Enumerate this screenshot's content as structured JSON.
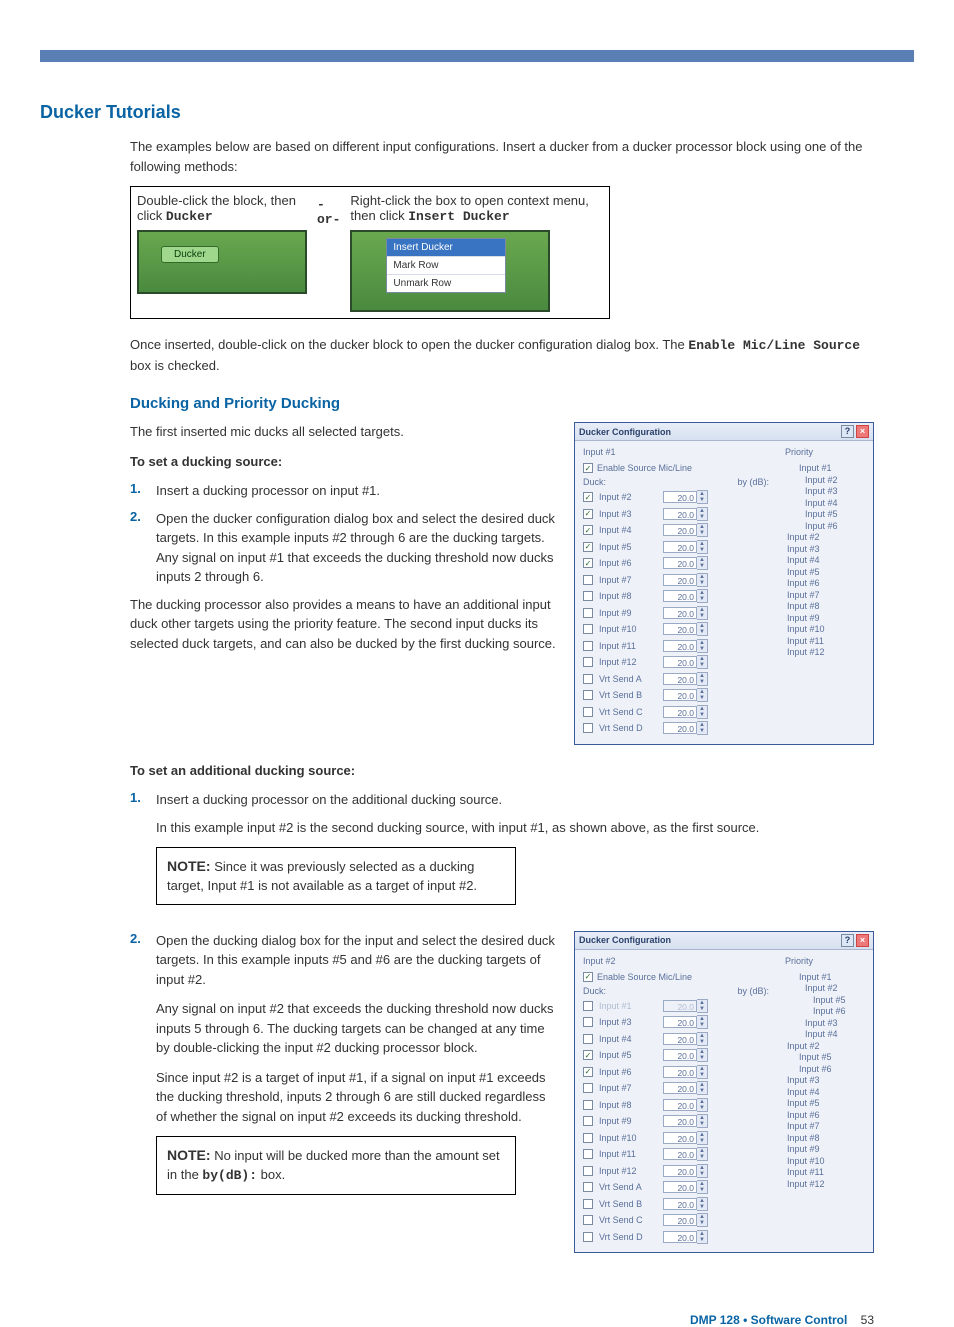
{
  "headings": {
    "h1": "Ducker Tutorials",
    "h2": "Ducking and Priority Ducking"
  },
  "intro": {
    "p1": "The examples below are based on different input configurations. Insert a ducker from a ducker processor block using one of the following methods:",
    "p2_a": "Once inserted, double-click on the ducker block to open the ducker configuration dialog box. The ",
    "p2_code": "Enable Mic/Line Source",
    "p2_b": " box is checked."
  },
  "insert_fig": {
    "left_a": "Double-click the block, then click ",
    "left_code": "Ducker",
    "or": "-or-",
    "right_a": "Right-click the box to open context menu, then click ",
    "right_code": "Insert Ducker",
    "pill": "Ducker",
    "ctx": [
      "Insert Ducker",
      "Mark Row",
      "Unmark Row"
    ]
  },
  "section1": {
    "p1": "The first inserted mic ducks all selected targets.",
    "h_src": "To set a ducking source:",
    "step1": "Insert a ducking processor on input #1.",
    "step2a": "Open the ducker configuration dialog box and select the desired duck targets. In this example inputs #2 through 6 are the ducking targets.",
    "step2b": "Any signal on input #1 that exceeds the ducking threshold now ducks inputs 2 through 6.",
    "p_after": "The ducking processor also provides a means to have an additional input duck other targets using the priority feature. The second input ducks its selected duck targets, and can also be ducked by the first ducking source."
  },
  "section2": {
    "h_add": "To set an additional ducking source:",
    "s1": "Insert a ducking processor on the additional ducking source.",
    "s1b": "In this example input #2 is the second ducking source, with input #1, as shown above, as the first source.",
    "note1_label": "NOTE:",
    "note1_body": "Since it was previously selected as a ducking target, Input #1 is not available as a target of input #2.",
    "s2a": "Open the ducking dialog box for the input and select the desired duck targets. In this example inputs #5 and #6 are the ducking targets of input #2.",
    "s2b": "Any signal on input #2 that exceeds the ducking threshold now ducks inputs 5 through 6. The ducking targets can be changed at any time by double-clicking the input #2 ducking processor block.",
    "s2c": "Since input #2 is a target of input #1, if a signal on input #1 exceeds the ducking threshold, inputs 2 through 6 are still ducked regardless of whether the signal on input #2 exceeds its ducking threshold.",
    "note2_label": "NOTE:",
    "note2_body_a": "No input will be ducked more than the amount set in the ",
    "note2_code": "by(dB):",
    "note2_body_b": " box."
  },
  "dlg1": {
    "title": "Ducker Configuration",
    "input_label": "Input #1",
    "enable": "Enable Source Mic/Line",
    "duck": "Duck:",
    "bydb": "by (dB):",
    "rows": [
      {
        "label": "Input #2",
        "checked": true,
        "val": "20.0"
      },
      {
        "label": "Input #3",
        "checked": true,
        "val": "20.0"
      },
      {
        "label": "Input #4",
        "checked": true,
        "val": "20.0"
      },
      {
        "label": "Input #5",
        "checked": true,
        "val": "20.0"
      },
      {
        "label": "Input #6",
        "checked": true,
        "val": "20.0"
      },
      {
        "label": "Input #7",
        "checked": false,
        "val": "20.0"
      },
      {
        "label": "Input #8",
        "checked": false,
        "val": "20.0"
      },
      {
        "label": "Input #9",
        "checked": false,
        "val": "20.0"
      },
      {
        "label": "Input #10",
        "checked": false,
        "val": "20.0"
      },
      {
        "label": "Input #11",
        "checked": false,
        "val": "20.0"
      },
      {
        "label": "Input #12",
        "checked": false,
        "val": "20.0"
      },
      {
        "label": "Vrt Send A",
        "checked": false,
        "val": "20.0"
      },
      {
        "label": "Vrt Send B",
        "checked": false,
        "val": "20.0"
      },
      {
        "label": "Vrt Send C",
        "checked": false,
        "val": "20.0"
      },
      {
        "label": "Vrt Send D",
        "checked": false,
        "val": "20.0"
      }
    ],
    "priority_label": "Priority",
    "tree": [
      {
        "t": "Input #1",
        "cls": "ind1"
      },
      {
        "t": "Input #2",
        "cls": "ind2"
      },
      {
        "t": "Input #3",
        "cls": "ind2"
      },
      {
        "t": "Input #4",
        "cls": "ind2"
      },
      {
        "t": "Input #5",
        "cls": "ind2"
      },
      {
        "t": "Input #6",
        "cls": "ind2"
      },
      {
        "t": "Input #2",
        "cls": "root"
      },
      {
        "t": "Input #3",
        "cls": "root"
      },
      {
        "t": "Input #4",
        "cls": "root"
      },
      {
        "t": "Input #5",
        "cls": "root"
      },
      {
        "t": "Input #6",
        "cls": "root"
      },
      {
        "t": "Input #7",
        "cls": "root"
      },
      {
        "t": "Input #8",
        "cls": "root"
      },
      {
        "t": "Input #9",
        "cls": "root"
      },
      {
        "t": "Input #10",
        "cls": "root"
      },
      {
        "t": "Input #11",
        "cls": "root"
      },
      {
        "t": "Input #12",
        "cls": "root"
      }
    ]
  },
  "dlg2": {
    "title": "Ducker Configuration",
    "input_label": "Input #2",
    "enable": "Enable Source Mic/Line",
    "duck": "Duck:",
    "bydb": "by (dB):",
    "rows": [
      {
        "label": "Input #1",
        "checked": false,
        "val": "20.0",
        "disabled": true
      },
      {
        "label": "Input #3",
        "checked": false,
        "val": "20.0"
      },
      {
        "label": "Input #4",
        "checked": false,
        "val": "20.0"
      },
      {
        "label": "Input #5",
        "checked": true,
        "val": "20.0"
      },
      {
        "label": "Input #6",
        "checked": true,
        "val": "20.0"
      },
      {
        "label": "Input #7",
        "checked": false,
        "val": "20.0"
      },
      {
        "label": "Input #8",
        "checked": false,
        "val": "20.0"
      },
      {
        "label": "Input #9",
        "checked": false,
        "val": "20.0"
      },
      {
        "label": "Input #10",
        "checked": false,
        "val": "20.0"
      },
      {
        "label": "Input #11",
        "checked": false,
        "val": "20.0"
      },
      {
        "label": "Input #12",
        "checked": false,
        "val": "20.0"
      },
      {
        "label": "Vrt Send A",
        "checked": false,
        "val": "20.0"
      },
      {
        "label": "Vrt Send B",
        "checked": false,
        "val": "20.0"
      },
      {
        "label": "Vrt Send C",
        "checked": false,
        "val": "20.0"
      },
      {
        "label": "Vrt Send D",
        "checked": false,
        "val": "20.0"
      }
    ],
    "priority_label": "Priority",
    "tree": [
      {
        "t": "Input #1",
        "cls": "ind1"
      },
      {
        "t": "Input #2",
        "cls": "ind2"
      },
      {
        "t": "Input #5",
        "cls": "ind2 extra"
      },
      {
        "t": "Input #6",
        "cls": "ind2 extra"
      },
      {
        "t": "Input #3",
        "cls": "ind2"
      },
      {
        "t": "Input #4",
        "cls": "ind2"
      },
      {
        "t": "Input #2",
        "cls": "root"
      },
      {
        "t": "Input #5",
        "cls": "ind1"
      },
      {
        "t": "Input #6",
        "cls": "ind1"
      },
      {
        "t": "Input #3",
        "cls": "root"
      },
      {
        "t": "Input #4",
        "cls": "root"
      },
      {
        "t": "Input #5",
        "cls": "root"
      },
      {
        "t": "Input #6",
        "cls": "root"
      },
      {
        "t": "Input #7",
        "cls": "root"
      },
      {
        "t": "Input #8",
        "cls": "root"
      },
      {
        "t": "Input #9",
        "cls": "root"
      },
      {
        "t": "Input #10",
        "cls": "root"
      },
      {
        "t": "Input #11",
        "cls": "root"
      },
      {
        "t": "Input #12",
        "cls": "root"
      }
    ]
  },
  "footer": {
    "product": "DMP 128 • Software Control",
    "page": "53"
  }
}
